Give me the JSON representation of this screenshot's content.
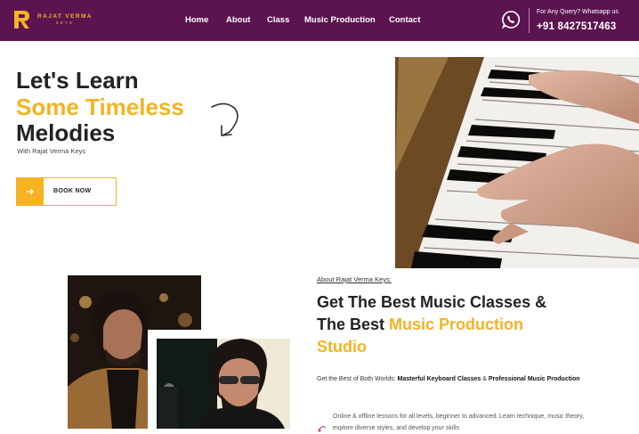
{
  "brand": {
    "name": "RAJAT VERMA",
    "sub": "KEYS"
  },
  "nav": {
    "items": [
      "Home",
      "About",
      "Class",
      "Music Production",
      "Contact"
    ]
  },
  "contact": {
    "query": "For Any Query? Whatsapp us",
    "phone": "+91 8427517463"
  },
  "hero": {
    "line1": "Let's Learn",
    "line2": "Some Timeless",
    "line3": "Melodies",
    "subtitle": "With Rajat Verma Keys",
    "button_label": "BOOK NOW"
  },
  "about": {
    "label": "About Rajat Verma Keys:",
    "heading_line1": "Get The Best Music Classes &",
    "heading_line2_plain": "The Best ",
    "heading_line2_highlight": "Music Production",
    "heading_line3": "Studio",
    "desc_plain1": "Get the Best of Both Worlds: ",
    "desc_bold1": "Masterful Keyboard Classes",
    "desc_plain2": " & ",
    "desc_bold2": "Professional Music Production",
    "feature_text": "Online & offline lessons for all levels, beginner to advanced. Learn technique, music theory, explore diverse styles, and develop your skills"
  },
  "colors": {
    "brand_purple": "#5b1450",
    "accent_yellow": "#f5b323",
    "text_dark": "#222222"
  },
  "icons": [
    "whatsapp-icon",
    "arrow-right-icon",
    "curved-arrow-icon",
    "music-note-icon"
  ]
}
